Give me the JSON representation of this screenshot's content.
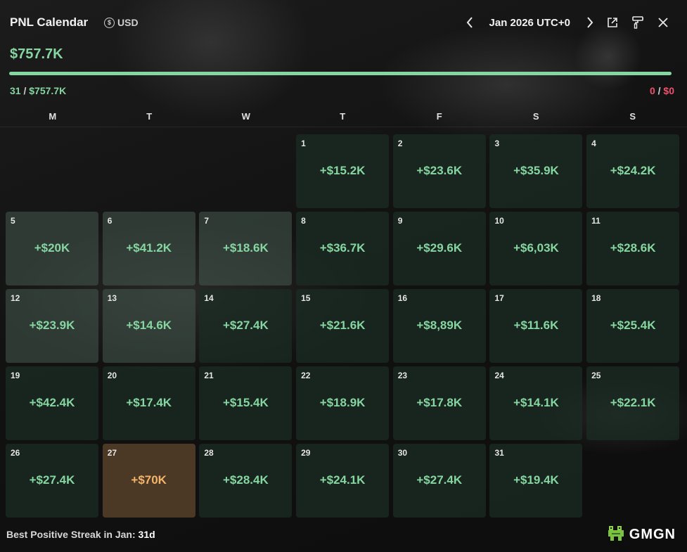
{
  "header": {
    "title": "PNL Calendar",
    "currency": "USD",
    "currency_icon": "dollar-coin-icon",
    "month_label": "Jan 2026 UTC+0"
  },
  "summary": {
    "total": "$757.7K",
    "progress_fraction": 1.0,
    "positive_days": "31",
    "positive_total": "$757.7K",
    "negative_days": "0",
    "negative_total": "$0",
    "separator": "/"
  },
  "weekdays": [
    "M",
    "T",
    "W",
    "T",
    "F",
    "S",
    "S"
  ],
  "days": [
    {
      "day": "1",
      "value": "+$15.2K"
    },
    {
      "day": "2",
      "value": "+$23.6K"
    },
    {
      "day": "3",
      "value": "+$35.9K"
    },
    {
      "day": "4",
      "value": "+$24.2K"
    },
    {
      "day": "5",
      "value": "+$20K"
    },
    {
      "day": "6",
      "value": "+$41.2K"
    },
    {
      "day": "7",
      "value": "+$18.6K"
    },
    {
      "day": "8",
      "value": "+$36.7K"
    },
    {
      "day": "9",
      "value": "+$29.6K"
    },
    {
      "day": "10",
      "value": "+$6,03K"
    },
    {
      "day": "11",
      "value": "+$28.6K"
    },
    {
      "day": "12",
      "value": "+$23.9K"
    },
    {
      "day": "13",
      "value": "+$14.6K"
    },
    {
      "day": "14",
      "value": "+$27.4K"
    },
    {
      "day": "15",
      "value": "+$21.6K"
    },
    {
      "day": "16",
      "value": "+$8,89K"
    },
    {
      "day": "17",
      "value": "+$11.6K"
    },
    {
      "day": "18",
      "value": "+$25.4K"
    },
    {
      "day": "19",
      "value": "+$42.4K"
    },
    {
      "day": "20",
      "value": "+$17.4K"
    },
    {
      "day": "21",
      "value": "+$15.4K"
    },
    {
      "day": "22",
      "value": "+$18.9K"
    },
    {
      "day": "23",
      "value": "+$17.8K"
    },
    {
      "day": "24",
      "value": "+$14.1K"
    },
    {
      "day": "25",
      "value": "+$22.1K"
    },
    {
      "day": "26",
      "value": "+$27.4K"
    },
    {
      "day": "27",
      "value": "+$70K"
    },
    {
      "day": "28",
      "value": "+$28.4K"
    },
    {
      "day": "29",
      "value": "+$24.1K"
    },
    {
      "day": "30",
      "value": "+$27.4K"
    },
    {
      "day": "31",
      "value": "+$19.4K"
    }
  ],
  "footer": {
    "streak_label": "Best Positive Streak in Jan:",
    "streak_value": "31d",
    "brand": "GMGN",
    "brand_icon": "frog-logo-icon"
  },
  "colors": {
    "positive": "#86d6a1",
    "negative": "#f0506e",
    "highlight": "#f3b56b"
  }
}
